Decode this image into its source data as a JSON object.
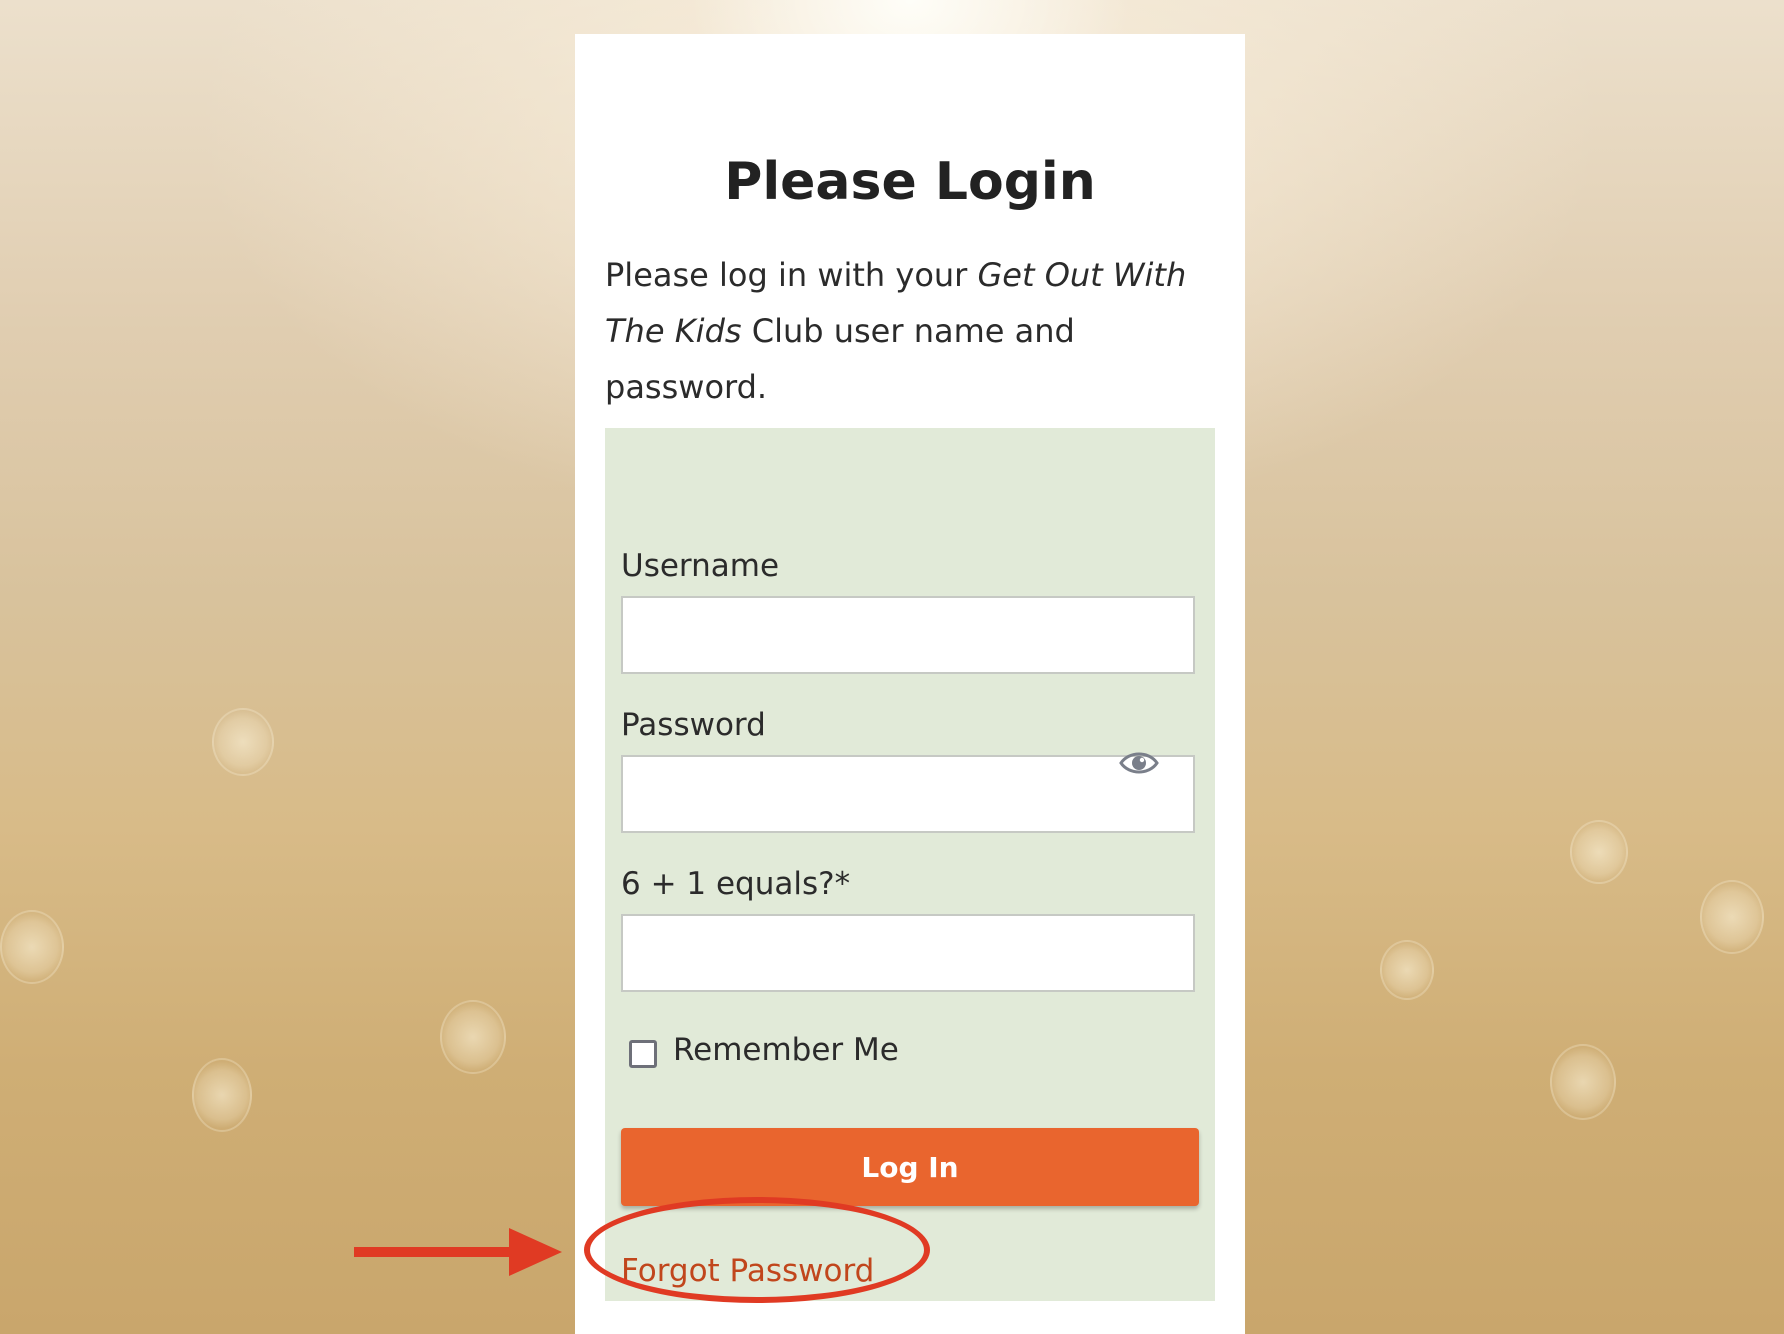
{
  "login": {
    "title": "Please Login",
    "intro_prefix": "Please log in with your ",
    "intro_club_name": "Get Out With The Kids",
    "intro_suffix": " Club user name and password."
  },
  "form": {
    "username_label": "Username",
    "username_value": "",
    "password_label": "Password",
    "password_value": "",
    "captcha_label": "6 + 1 equals?*",
    "captcha_value": "",
    "remember_label": "Remember Me",
    "remember_checked": false,
    "login_button_label": "Log In",
    "forgot_password_label": "Forgot Password"
  },
  "icons": {
    "password_toggle": "eye-icon",
    "annotation": "arrow-icon"
  },
  "colors": {
    "accent_button": "#e9652e",
    "link": "#c1461c",
    "form_panel_bg": "#e1ead8",
    "annotation": "#e03a23"
  }
}
